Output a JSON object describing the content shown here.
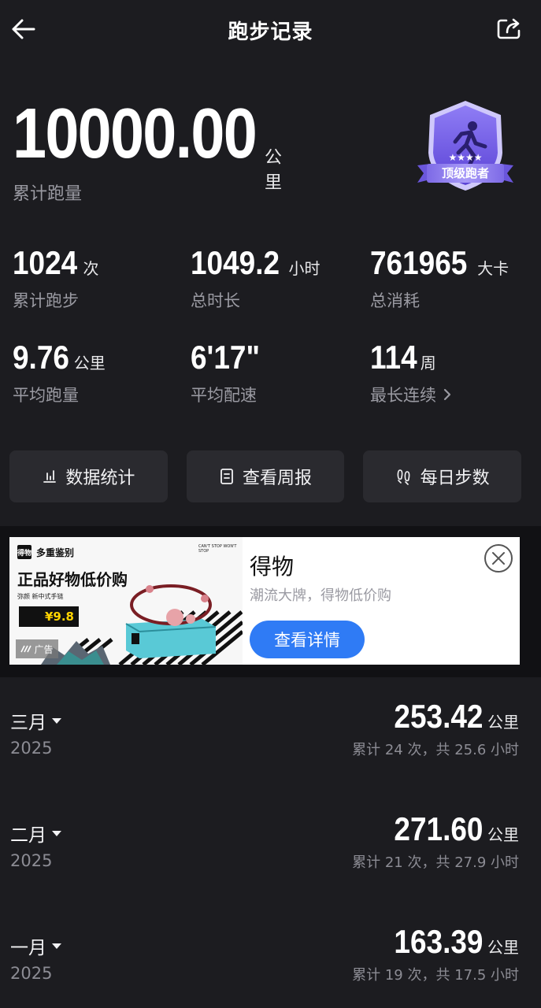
{
  "header": {
    "title": "跑步记录",
    "back_icon": "arrow-left-icon",
    "share_icon": "share-icon"
  },
  "total": {
    "value": "10000.00",
    "unit": "公里",
    "label": "累计跑量"
  },
  "badge": {
    "label": "顶级跑者",
    "stars": 4,
    "colors": {
      "primary": "#6b55e0",
      "ribbon": "#8b77f0"
    }
  },
  "stats": [
    {
      "value": "1024",
      "unit": "次",
      "label": "累计跑步"
    },
    {
      "value": "1049.2",
      "unit": "小时",
      "label": "总时长"
    },
    {
      "value": "761965",
      "unit": "大卡",
      "label": "总消耗"
    },
    {
      "value": "9.76",
      "unit": "公里",
      "label": "平均跑量"
    },
    {
      "value": "6'17\"",
      "unit": "",
      "label": "平均配速"
    },
    {
      "value": "114",
      "unit": "周",
      "label": "最长连续"
    }
  ],
  "actions": [
    {
      "label": "数据统计",
      "icon": "bar-chart-icon"
    },
    {
      "label": "查看周报",
      "icon": "report-icon"
    },
    {
      "label": "每日步数",
      "icon": "footprints-icon"
    }
  ],
  "ad": {
    "brand": "多重鉴别",
    "brand_logo": "得物",
    "top_tiny": "CAN'T STOP WON'T STOP",
    "headline": "正品好物低价购",
    "sub": "弥颜 新中式手链",
    "price": "¥9.8",
    "tag": "广告",
    "title": "得物",
    "desc": "潮流大牌，得物低价购",
    "cta": "查看详情",
    "close_icon": "close-circle-icon"
  },
  "months": [
    {
      "name": "三月",
      "year": "2025",
      "distance": "253.42",
      "unit": "公里",
      "summary": "累计 24 次，共 25.6 小时"
    },
    {
      "name": "二月",
      "year": "2025",
      "distance": "271.60",
      "unit": "公里",
      "summary": "累计 21 次，共 27.9 小时"
    },
    {
      "name": "一月",
      "year": "2025",
      "distance": "163.39",
      "unit": "公里",
      "summary": "累计 19 次，共 17.5 小时"
    }
  ],
  "colors": {
    "background": "#1c1c20",
    "card": "#2a2a2f",
    "muted": "#9a9aa2",
    "accent": "#2f7bf5"
  }
}
